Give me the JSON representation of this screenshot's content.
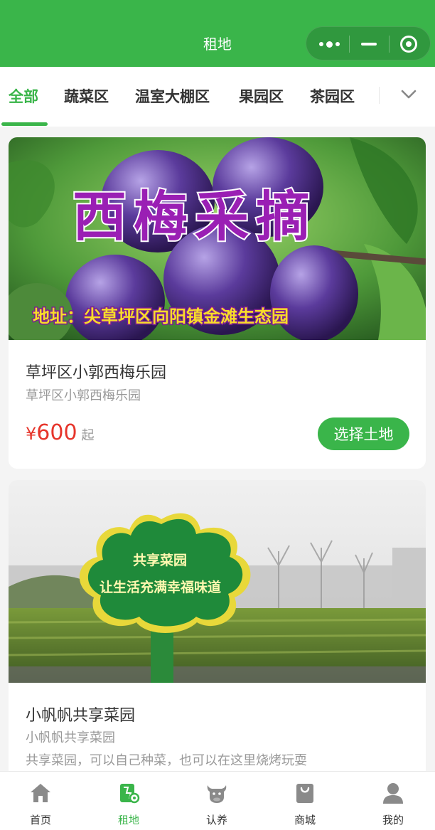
{
  "header": {
    "title": "租地",
    "background": "#3ab54a",
    "capsule_icons": [
      "more-dots-icon",
      "minimize-icon",
      "close-target-icon"
    ]
  },
  "tabs": {
    "items": [
      "全部",
      "蔬菜区",
      "温室大棚区",
      "果园区",
      "茶园区"
    ],
    "active_index": 0,
    "expand_icon": "chevron-down-icon"
  },
  "cards": [
    {
      "image_text_title": "西梅采摘",
      "image_text_address": "地址：尖草坪区向阳镇金滩生态园",
      "title": "草坪区小郭西梅乐园",
      "subtitle": "草坪区小郭西梅乐园",
      "price_currency": "¥",
      "price_amount": "600",
      "price_suffix": "起",
      "button_label": "选择土地"
    },
    {
      "image_text_line1": "共享菜园",
      "image_text_line2": "让生活充满幸福味道",
      "title": "小帆帆共享菜园",
      "subtitle": "小帆帆共享菜园",
      "description": "共享菜园，可以自己种菜，也可以在这里烧烤玩耍"
    }
  ],
  "bottom_nav": {
    "items": [
      {
        "label": "首页",
        "icon": "home-icon"
      },
      {
        "label": "租地",
        "icon": "land-map-icon"
      },
      {
        "label": "认养",
        "icon": "cow-icon"
      },
      {
        "label": "商城",
        "icon": "shopping-bag-icon"
      },
      {
        "label": "我的",
        "icon": "user-icon"
      }
    ],
    "active_index": 1
  },
  "colors": {
    "accent": "#3ab54a",
    "price": "#e6352b",
    "muted_text": "#999999",
    "body_text": "#333333",
    "background": "#f4f4f4"
  }
}
